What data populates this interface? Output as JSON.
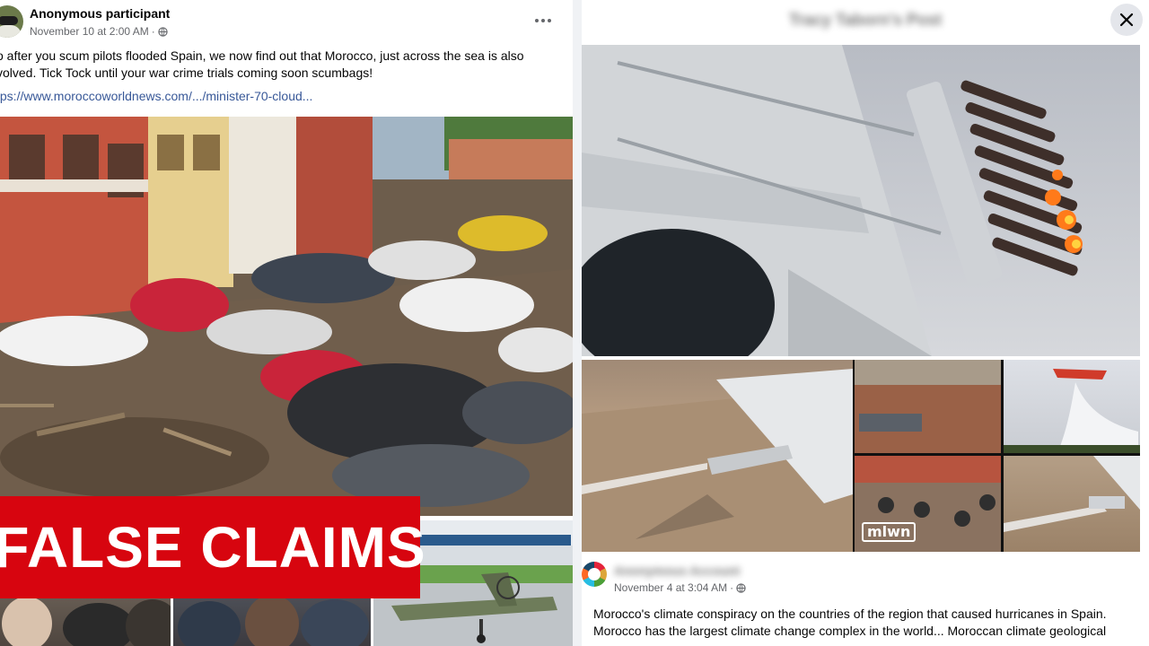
{
  "left_post": {
    "author": "Anonymous participant",
    "timestamp": "November 10 at 2:00 AM",
    "separator": "·",
    "audience_icon": "globe-icon",
    "more_icon": "more-options-icon",
    "text_line1": "o after you scum pilots flooded Spain, we now find out that Morocco, just across the sea is also",
    "text_line2": "volved. Tick Tock until your war crime trials coming soon scumbags!",
    "link": "tps://www.moroccoworldnews.com/.../minister-70-cloud..."
  },
  "banner": {
    "label": "FALSE CLAIMS",
    "color": "#d7050f"
  },
  "right_post": {
    "title": "Tracy Taborn's Post",
    "close_icon": "close-icon",
    "watermark": "mlwn",
    "comment": {
      "author": "Anonymous Account",
      "timestamp": "November 4 at 3:04 AM",
      "separator": "·",
      "audience_icon": "globe-icon",
      "text_line1": "Morocco's climate conspiracy on the countries of the region that caused hurricanes in Spain.",
      "text_line2": "Morocco has the largest climate change complex in the world... Moroccan climate geological"
    }
  },
  "colors": {
    "link": "#385898",
    "meta": "#65676b",
    "separator_bg": "#f0f2f5"
  }
}
